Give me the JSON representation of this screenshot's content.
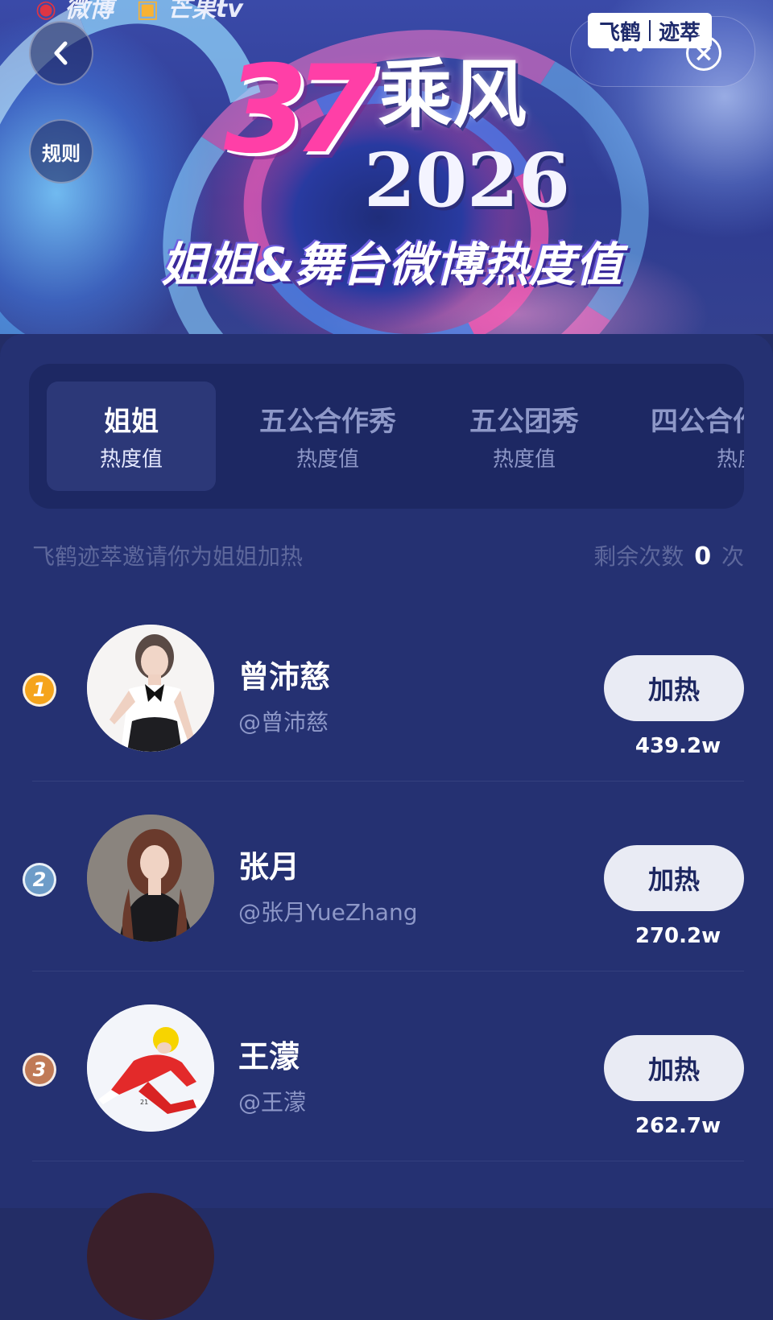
{
  "top_logos": {
    "weibo": "微博",
    "mango": "芒果tv"
  },
  "header": {
    "back_label": "<",
    "rules_label": "规则",
    "brand": {
      "left": "飞鹤",
      "right": "迹萃"
    },
    "more": "•••",
    "close": "×"
  },
  "banner": {
    "logo": "37",
    "title": "乘风",
    "year": "2026",
    "subtitle": "姐姐&舞台微博热度值"
  },
  "tabs": [
    {
      "title": "姐姐",
      "sub": "热度值",
      "active": true
    },
    {
      "title": "五公合作秀",
      "sub": "热度值",
      "active": false
    },
    {
      "title": "五公团秀",
      "sub": "热度值",
      "active": false
    },
    {
      "title": "四公合作",
      "sub": "热度值",
      "active": false
    }
  ],
  "invite_text": "飞鹤迹萃邀请你为姐姐加热",
  "remaining": {
    "prefix": "剩余次数",
    "count": "0",
    "suffix": "次"
  },
  "contestants": [
    {
      "rank": "1",
      "name": "曾沛慈",
      "handle": "@曾沛慈",
      "button": "加热",
      "score": "439.2w",
      "rank_color": "#f5a41c"
    },
    {
      "rank": "2",
      "name": "张月",
      "handle": "@张月YueZhang",
      "button": "加热",
      "score": "270.2w",
      "rank_color": "#6d9cc8"
    },
    {
      "rank": "3",
      "name": "王濛",
      "handle": "@王濛",
      "button": "加热",
      "score": "262.7w",
      "rank_color": "#c07a56"
    }
  ]
}
